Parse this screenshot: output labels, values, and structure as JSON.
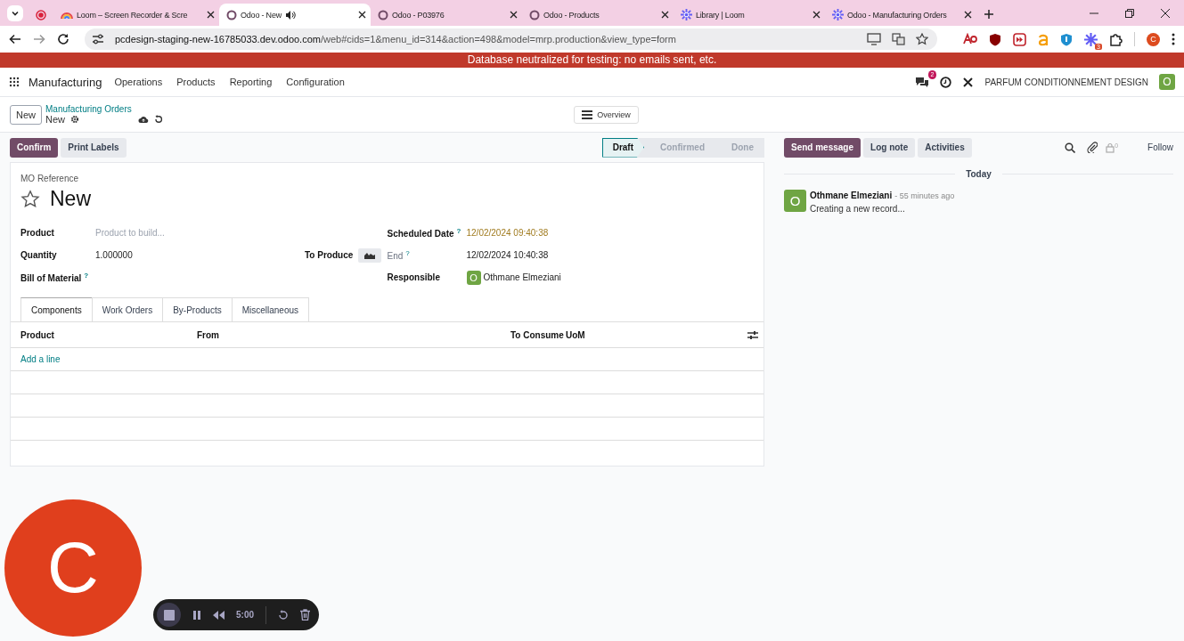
{
  "browser": {
    "tabs": [
      {
        "kind": "record",
        "selected": false
      },
      {
        "kind": "rainbow",
        "title": "Loom – Screen Recorder & Scre",
        "selected": false
      },
      {
        "kind": "odoo",
        "title": "Odoo - New",
        "selected": true,
        "audio": true
      },
      {
        "kind": "odoo",
        "title": "Odoo - P03976",
        "selected": false
      },
      {
        "kind": "odoo",
        "title": "Odoo - Products",
        "selected": false
      },
      {
        "kind": "flower",
        "title": "Library | Loom",
        "selected": false
      },
      {
        "kind": "flower",
        "title": "Odoo - Manufacturing Orders",
        "selected": false
      }
    ],
    "url_host": "pcdesign-staging-new-16785033.dev.odoo.com",
    "url_path": "/web#cids=1&menu_id=314&action=498&model=mrp.production&view_type=form",
    "extension_badge": "3",
    "profile": "C"
  },
  "banner": "Database neutralized for testing: no emails sent, etc.",
  "navbar": {
    "app": "Manufacturing",
    "menus": [
      "Operations",
      "Products",
      "Reporting",
      "Configuration"
    ],
    "messages_count": "2",
    "company": "PARFUM CONDITIONNEMENT DESIGN",
    "avatar": "O"
  },
  "control_panel": {
    "new_button": "New",
    "breadcrumb": "Manufacturing Orders",
    "record": "New",
    "view_button": "Overview"
  },
  "actions": [
    {
      "label": "Confirm",
      "kind": "primary"
    },
    {
      "label": "Print Labels",
      "kind": "secondary"
    }
  ],
  "statusbar": [
    {
      "label": "Draft",
      "selected": true
    },
    {
      "label": "Confirmed",
      "selected": false
    },
    {
      "label": "Done",
      "selected": false
    }
  ],
  "form": {
    "reference_label": "MO Reference",
    "name": "New",
    "starred": false,
    "left_fields": [
      {
        "label": "Product",
        "placeholder": "Product to build..."
      },
      {
        "label": "Quantity",
        "value": "1.000000",
        "extra_label": "To Produce"
      },
      {
        "label": "Bill of Material",
        "help": "?"
      }
    ],
    "right_fields": [
      {
        "label": "Scheduled Date",
        "value": "12/02/2024 09:40:38",
        "help": "?",
        "warning": true
      },
      {
        "label": "End",
        "value": "12/02/2024 10:40:38",
        "help": "?",
        "muted": true
      },
      {
        "label": "Responsible",
        "value": "Othmane Elmeziani",
        "avatar": "O"
      }
    ],
    "tabs": [
      {
        "label": "Components",
        "selected": true
      },
      {
        "label": "Work Orders",
        "selected": false
      },
      {
        "label": "By-Products",
        "selected": false
      },
      {
        "label": "Miscellaneous",
        "selected": false
      }
    ],
    "columns": [
      "Product",
      "From",
      "To Consume",
      "UoM"
    ],
    "add_line": "Add a line"
  },
  "chatter": {
    "buttons": [
      {
        "label": "Send message",
        "kind": "primary"
      },
      {
        "label": "Log note",
        "kind": "secondary"
      },
      {
        "label": "Activities",
        "kind": "secondary"
      }
    ],
    "followers_count": "0",
    "follow": "Follow",
    "separator": "Today",
    "messages": [
      {
        "author": "Othmane Elmeziani",
        "avatar": "O",
        "time": "- 55 minutes ago",
        "body": "Creating a new record..."
      }
    ]
  },
  "recorder": {
    "avatar": "C",
    "timer": "5:00"
  }
}
